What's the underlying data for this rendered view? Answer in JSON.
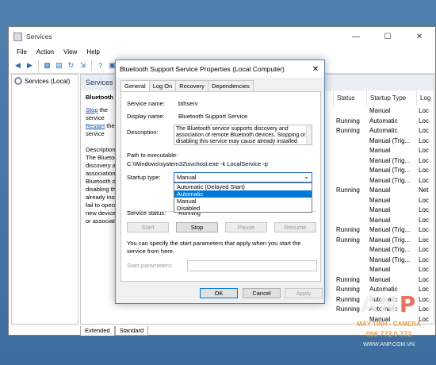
{
  "window": {
    "title": "Services"
  },
  "window_controls": {
    "minimize": "—",
    "maximize": "☐",
    "close": "✕"
  },
  "menu": [
    "File",
    "Action",
    "View",
    "Help"
  ],
  "tree": {
    "label": "Services (Local)"
  },
  "main_pane": {
    "header": "Services (Local)",
    "service_name": "Bluetooth Support Service",
    "stop_link": "Stop",
    "stop_suffix": " the service",
    "restart_link": "Restart",
    "restart_suffix": " the service",
    "description_lines": [
      "Description:",
      "The Bluetooth service supports",
      "discovery and",
      "association of remote",
      "Bluetooth devices.",
      "disabling this service",
      "already installed",
      "fail to operate",
      "new devices",
      "or associated"
    ]
  },
  "columns": {
    "status": "Status",
    "startup": "Startup Type",
    "logon": "Log"
  },
  "rows": [
    {
      "status": "",
      "startup": "Manual",
      "logon": "Loc"
    },
    {
      "status": "Running",
      "startup": "Automatic",
      "logon": "Loc"
    },
    {
      "status": "Running",
      "startup": "Automatic",
      "logon": "Loc"
    },
    {
      "status": "",
      "startup": "Manual (Trig...",
      "logon": "Loc"
    },
    {
      "status": "",
      "startup": "Manual",
      "logon": "Loc"
    },
    {
      "status": "",
      "startup": "Manual (Trig...",
      "logon": "Loc"
    },
    {
      "status": "",
      "startup": "Manual (Trig...",
      "logon": "Loc"
    },
    {
      "status": "",
      "startup": "Manual (Trig...",
      "logon": "Loc"
    },
    {
      "status": "Running",
      "startup": "Manual",
      "logon": "Net"
    },
    {
      "status": "",
      "startup": "Manual",
      "logon": "Loc"
    },
    {
      "status": "",
      "startup": "Manual",
      "logon": "Loc"
    },
    {
      "status": "",
      "startup": "Manual",
      "logon": "Loc"
    },
    {
      "status": "Running",
      "startup": "Manual (Trig...",
      "logon": "Loc"
    },
    {
      "status": "Running",
      "startup": "Manual (Trig...",
      "logon": "Loc"
    },
    {
      "status": "",
      "startup": "Manual (Trig...",
      "logon": "Loc"
    },
    {
      "status": "",
      "startup": "Manual (Trig...",
      "logon": "Loc"
    },
    {
      "status": "",
      "startup": "Manual",
      "logon": "Loc"
    },
    {
      "status": "Running",
      "startup": "Manual",
      "logon": "Loc"
    },
    {
      "status": "Running",
      "startup": "Automatic",
      "logon": "Loc"
    },
    {
      "status": "Running",
      "startup": "Automatic",
      "logon": "Loc"
    },
    {
      "status": "Running",
      "startup": "Automatic",
      "logon": "Loc"
    },
    {
      "status": "",
      "startup": "Manual",
      "logon": "Loc"
    },
    {
      "status": "",
      "startup": "Manual",
      "logon": "Loc"
    }
  ],
  "bottom_tabs": [
    "Extended",
    "Standard"
  ],
  "dialog": {
    "title": "Bluetooth Support Service Properties (Local Computer)",
    "close": "✕",
    "tabs": [
      "General",
      "Log On",
      "Recovery",
      "Dependencies"
    ],
    "service_name_label": "Service name:",
    "service_name": "bthserv",
    "display_name_label": "Display name:",
    "display_name": "Bluetooth Support Service",
    "description_label": "Description:",
    "description": "The Bluetooth service supports discovery and association of remote Bluetooth devices.  Stopping or disabling this service may cause already installed",
    "path_label": "Path to executable:",
    "path": "C:\\Windows\\system32\\svchost.exe -k LocalService -p",
    "startup_type_label": "Startup type:",
    "startup_type_value": "Manual",
    "startup_options": [
      "Automatic (Delayed Start)",
      "Automatic",
      "Manual",
      "Disabled"
    ],
    "service_status_label": "Service status:",
    "service_status": "Running",
    "buttons": {
      "start": "Start",
      "stop": "Stop",
      "pause": "Pause",
      "resume": "Resume"
    },
    "help_text": "You can specify the start parameters that apply when you start the service from here.",
    "start_params_label": "Start parameters:",
    "ok": "OK",
    "cancel": "Cancel",
    "apply": "Apply"
  },
  "watermark": {
    "logo_a": "A",
    "logo_n": "N",
    "logo_p": "P",
    "line1": "MÁY TÍNH - CAMERA",
    "line2": "098 772 0 772",
    "line3": "WWW.ANP.COM.VN"
  },
  "colors": {
    "accent": "#0078d7",
    "link": "#0645ad",
    "desktop": "#4a7aa8"
  }
}
